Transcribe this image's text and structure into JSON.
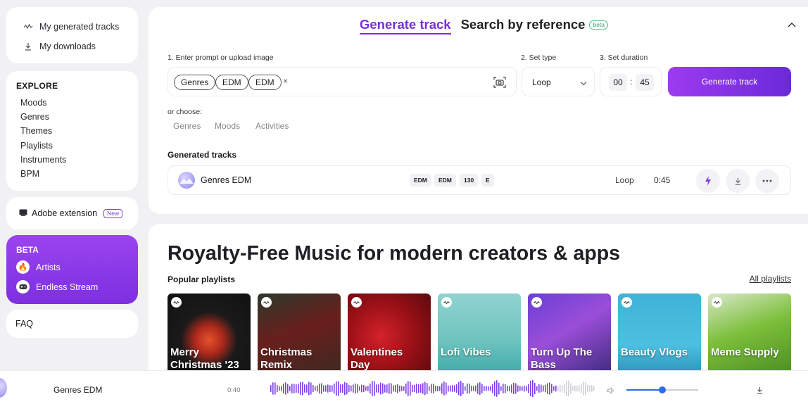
{
  "sidebar": {
    "my_generated": "My generated tracks",
    "my_downloads": "My downloads",
    "explore_title": "EXPLORE",
    "explore_items": [
      "Moods",
      "Genres",
      "Themes",
      "Playlists",
      "Instruments",
      "BPM"
    ],
    "adobe": "Adobe extension",
    "adobe_badge": "New",
    "beta_title": "BETA",
    "beta_items": [
      "Artists",
      "Endless Stream"
    ],
    "faq": "FAQ"
  },
  "generator": {
    "tab_active": "Generate track",
    "tab_other": "Search by reference",
    "tab_badge": "beta",
    "step1": "1. Enter prompt or upload image",
    "step2": "2. Set type",
    "step3": "3. Set duration",
    "chips": [
      "Genres",
      "EDM",
      "EDM"
    ],
    "chip_clear": "×",
    "type_value": "Loop",
    "duration_min": "00",
    "duration_sep": ":",
    "duration_sec": "45",
    "generate_label": "Generate track",
    "or_choose": "or choose:",
    "choose_options": [
      "Genres",
      "Moods",
      "Activities"
    ],
    "generated_title": "Generated tracks",
    "track": {
      "title": "Genres EDM",
      "tags": [
        "EDM",
        "EDM",
        "130",
        "E"
      ],
      "type": "Loop",
      "duration": "0:45"
    }
  },
  "main": {
    "hero": "Royalty-Free Music for modern creators & apps",
    "popular": "Popular playlists",
    "all_playlists": "All playlists",
    "playlists": [
      {
        "line1": "Merry",
        "line2": "Christmas '23"
      },
      {
        "line1": "Christmas",
        "line2": "Remix"
      },
      {
        "line1": "Valentines",
        "line2": "Day"
      },
      {
        "line1": "Lofi Vibes",
        "line2": ""
      },
      {
        "line1": "Turn Up The",
        "line2": "Bass"
      },
      {
        "line1": "Beauty Vlogs",
        "line2": ""
      },
      {
        "line1": "Meme Supply",
        "line2": ""
      }
    ]
  },
  "player": {
    "title": "Genres EDM",
    "time": "0:40",
    "progress": 0.88,
    "volume": 0.5
  },
  "colors": {
    "accent": "#7a2fd6",
    "progress_played": "#7b3fe4",
    "volume": "#2a6be8"
  }
}
